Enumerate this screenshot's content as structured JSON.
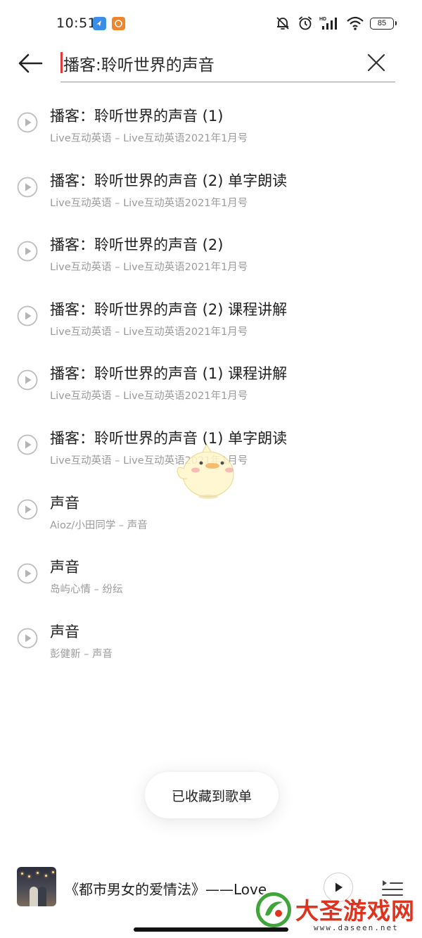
{
  "status_bar": {
    "time": "10:51",
    "battery": "85",
    "icons": [
      "notification-app-blue-icon",
      "notification-app-orange-icon",
      "mute-icon",
      "alarm-icon",
      "hd-signal-icon",
      "wifi-icon",
      "battery-icon"
    ]
  },
  "search": {
    "query": "播客:聆听世界的声音",
    "back_icon": "back-arrow-icon",
    "clear_icon": "close-icon"
  },
  "results": [
    {
      "title": "播客：聆听世界的声音 (1)",
      "subtitle": "Live互动英语 – Live互动英语2021年1月号"
    },
    {
      "title": "播客：聆听世界的声音 (2) 单字朗读",
      "subtitle": "Live互动英语 – Live互动英语2021年1月号"
    },
    {
      "title": "播客：聆听世界的声音 (2)",
      "subtitle": "Live互动英语 – Live互动英语2021年1月号"
    },
    {
      "title": "播客：聆听世界的声音 (2) 课程讲解",
      "subtitle": "Live互动英语 – Live互动英语2021年1月号"
    },
    {
      "title": "播客：聆听世界的声音 (1) 课程讲解",
      "subtitle": "Live互动英语 – Live互动英语2021年1月号"
    },
    {
      "title": "播客：聆听世界的声音 (1) 单字朗读",
      "subtitle": "Live互动英语 – Live互动英语2021年1月号"
    },
    {
      "title": "声音",
      "subtitle": "Aioz/小田同学 – 声音"
    },
    {
      "title": "声音",
      "subtitle": "岛屿心情 – 纷纭"
    },
    {
      "title": "声音",
      "subtitle": "彭健新 – 声音"
    }
  ],
  "toast": {
    "text": "已收藏到歌单"
  },
  "mini_player": {
    "now_playing": "《都市男女的爱情法》——Love...",
    "play_icon": "play-icon",
    "playlist_icon": "playlist-icon"
  },
  "watermark": {
    "title": "大圣游戏网",
    "url": "www.daseen.net"
  },
  "colors": {
    "accent_caret": "#e23a3a",
    "watermark_red": "#e0331f",
    "subtitle_gray": "#9b9b9b"
  }
}
